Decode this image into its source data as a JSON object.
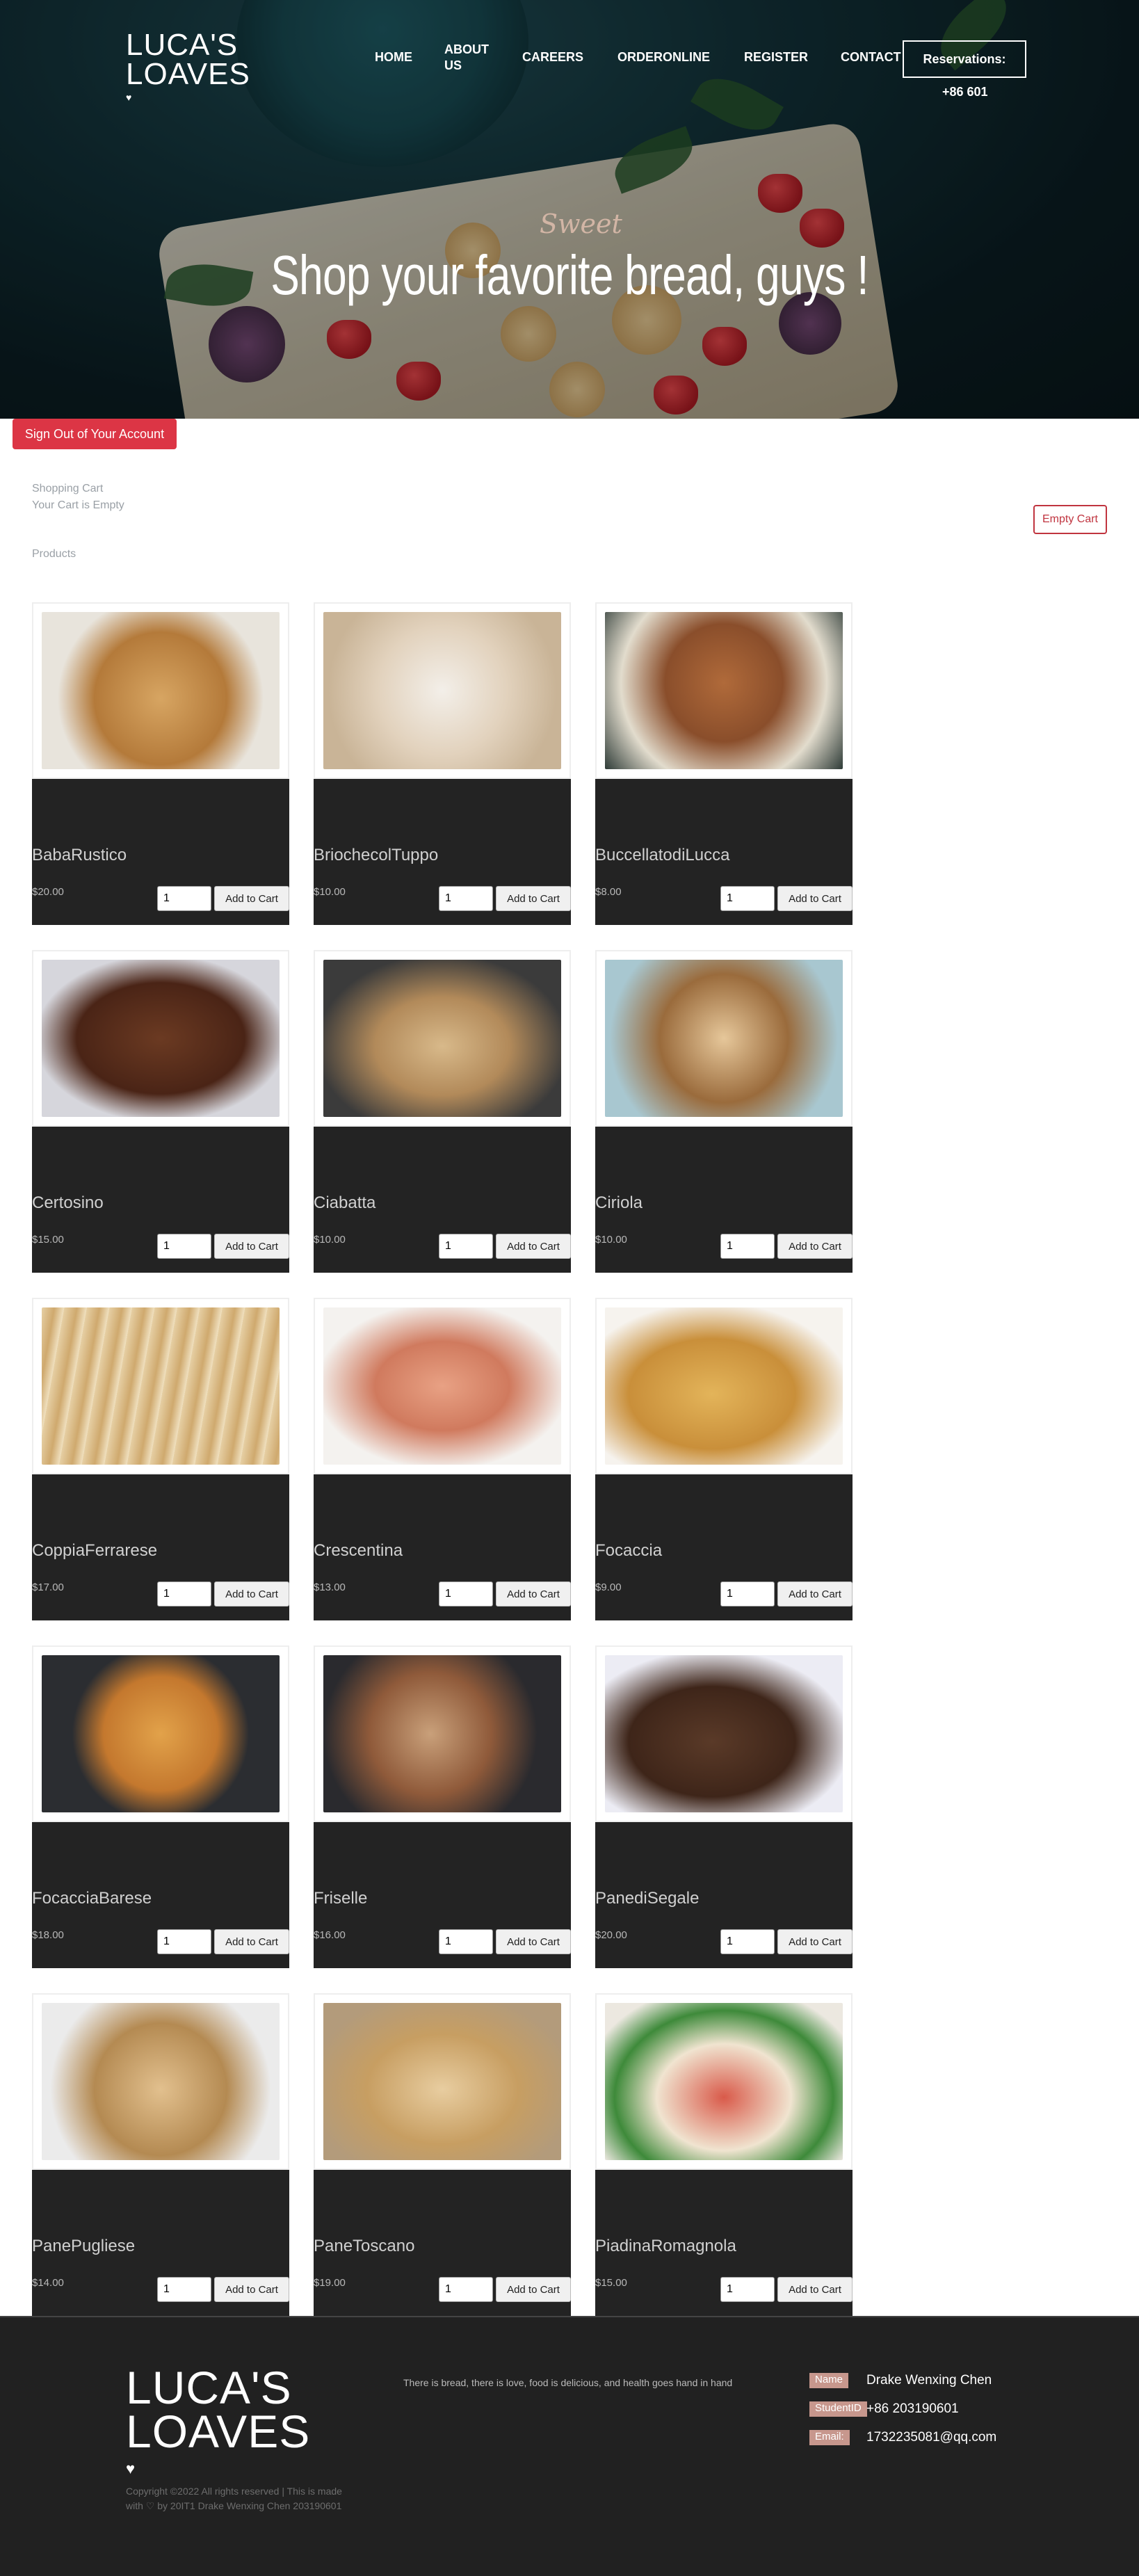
{
  "brand": {
    "line1": "LUCA'S",
    "line2": "LOAVES",
    "heart": "♥"
  },
  "nav": {
    "items": [
      "HOME",
      "ABOUT US",
      "CAREERS",
      "ORDERONLINE",
      "REGISTER",
      "CONTACT"
    ],
    "reservations_label": "Reservations:",
    "phone": "+86 601"
  },
  "hero": {
    "script": "Sweet",
    "title": "Shop your favorite bread, guys !"
  },
  "account": {
    "signout_label": "Sign Out of Your Account"
  },
  "cart": {
    "title": "Shopping Cart",
    "status": "Your Cart is Empty",
    "empty_label": "Empty Cart"
  },
  "products": {
    "title": "Products",
    "add_label": "Add to Cart",
    "items": [
      {
        "name": "BabaRustico",
        "price": "$20.00",
        "qty": "1"
      },
      {
        "name": "BriochecolTuppo",
        "price": "$10.00",
        "qty": "1"
      },
      {
        "name": "BuccellatodiLucca",
        "price": "$8.00",
        "qty": "1"
      },
      {
        "name": "Certosino",
        "price": "$15.00",
        "qty": "1"
      },
      {
        "name": "Ciabatta",
        "price": "$10.00",
        "qty": "1"
      },
      {
        "name": "Ciriola",
        "price": "$10.00",
        "qty": "1"
      },
      {
        "name": "CoppiaFerrarese",
        "price": "$17.00",
        "qty": "1"
      },
      {
        "name": "Crescentina",
        "price": "$13.00",
        "qty": "1"
      },
      {
        "name": "Focaccia",
        "price": "$9.00",
        "qty": "1"
      },
      {
        "name": "FocacciaBarese",
        "price": "$18.00",
        "qty": "1"
      },
      {
        "name": "Friselle",
        "price": "$16.00",
        "qty": "1"
      },
      {
        "name": "PanediSegale",
        "price": "$20.00",
        "qty": "1"
      },
      {
        "name": "PanePugliese",
        "price": "$14.00",
        "qty": "1"
      },
      {
        "name": "PaneToscano",
        "price": "$19.00",
        "qty": "1"
      },
      {
        "name": "PiadinaRomagnola",
        "price": "$15.00",
        "qty": "1"
      }
    ]
  },
  "footer": {
    "tagline": "There is bread, there is love, food is delicious, and health goes hand in hand",
    "copyright": "Copyright ©2022 All rights reserved | This is made with ♡ by 20IT1 Drake Wenxing Chen 203190601",
    "info": [
      {
        "label": "Name",
        "value": "Drake Wenxing Chen"
      },
      {
        "label": "StudentID",
        "value": "+86 203190601"
      },
      {
        "label": "Email:",
        "value": "1732235081@qq.com"
      }
    ]
  },
  "colors": {
    "danger": "#dc3545",
    "dark": "#232323",
    "label_bg": "#c7978d"
  }
}
